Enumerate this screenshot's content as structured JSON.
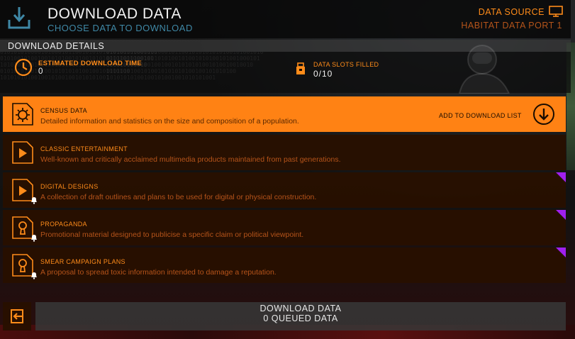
{
  "header": {
    "title": "DOWNLOAD DATA",
    "subtitle": "CHOOSE DATA TO DOWNLOAD",
    "source_label": "DATA SOURCE",
    "source_value": "HABITAT DATA PORT 1",
    "icon": "download-icon",
    "source_icon": "monitor-icon"
  },
  "details": {
    "title": "DOWNLOAD DETAILS",
    "time_label": "ESTIMATED DOWNLOAD TIME",
    "time_value": "0",
    "slots_label": "DATA SLOTS FILLED",
    "slots_value": "0/10",
    "binary": "0101010100001010001011001010101010100101001010\n010100101001001010100101001010100101001000101\n1010101010100100100101010101001010010010010\n01010101001010010101010100100101010100\n10101010100100101001001010101001"
  },
  "items": [
    {
      "name": "CENSUS DATA",
      "desc": "Detailed information and statistics on the size and composition of a population.",
      "icon": "gear-icon",
      "selected": true
    },
    {
      "name": "CLASSIC ENTERTAINMENT",
      "desc": "Well-known and critically acclaimed multimedia products maintained from past generations.",
      "icon": "play-icon"
    },
    {
      "name": "DIGITAL DESIGNS",
      "desc": "A collection of draft outlines and plans to be used for digital or physical construction.",
      "icon": "play-icon"
    },
    {
      "name": "PROPAGANDA",
      "desc": "Promotional material designed to publicise a specific claim or political viewpoint.",
      "icon": "keyhole-icon"
    },
    {
      "name": "SMEAR CAMPAIGN PLANS",
      "desc": "A proposal to spread toxic information intended to damage a reputation.",
      "icon": "keyhole-icon"
    }
  ],
  "add_label": "ADD TO DOWNLOAD LIST",
  "footer": {
    "line1": "DOWNLOAD DATA",
    "line2": "0 QUEUED DATA"
  },
  "colors": {
    "accent": "#ff8214",
    "subtitle_blue": "#3f88a6",
    "rare_marker": "#a020f0"
  }
}
